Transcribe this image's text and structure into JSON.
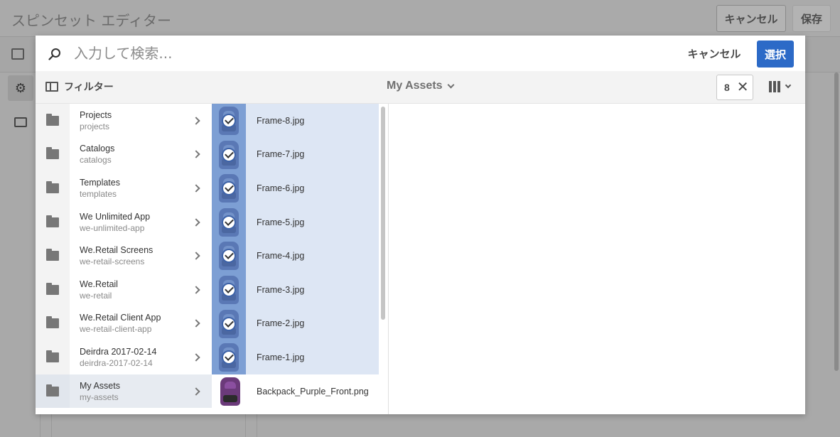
{
  "editor": {
    "title": "スピンセット エディター",
    "cancel_label": "キャンセル",
    "save_label": "保存"
  },
  "picker": {
    "search": {
      "placeholder": "入力して検索...",
      "value": ""
    },
    "cancel_label": "キャンセル",
    "select_label": "選択",
    "filter_label": "フィルター",
    "location_label": "My Assets",
    "selected_count": "8",
    "icons": {
      "search": "search-icon",
      "filter": "filter-panel-icon",
      "chevron": "chevron-down-icon",
      "close": "close-icon",
      "view": "column-view-icon",
      "folder": "folder-icon",
      "check": "checkmark-icon"
    },
    "nav": [
      {
        "title": "Projects",
        "path": "projects",
        "active": false
      },
      {
        "title": "Catalogs",
        "path": "catalogs",
        "active": false
      },
      {
        "title": "Templates",
        "path": "templates",
        "active": false
      },
      {
        "title": "We Unlimited App",
        "path": "we-unlimited-app",
        "active": false
      },
      {
        "title": "We.Retail Screens",
        "path": "we-retail-screens",
        "active": false
      },
      {
        "title": "We.Retail",
        "path": "we-retail",
        "active": false
      },
      {
        "title": "We.Retail Client App",
        "path": "we-retail-client-app",
        "active": false
      },
      {
        "title": "Deirdra 2017-02-14",
        "path": "deirdra-2017-02-14",
        "active": false
      },
      {
        "title": "My Assets",
        "path": "my-assets",
        "active": true
      }
    ],
    "assets": [
      {
        "name": "Frame-8.jpg",
        "selected": true
      },
      {
        "name": "Frame-7.jpg",
        "selected": true
      },
      {
        "name": "Frame-6.jpg",
        "selected": true
      },
      {
        "name": "Frame-5.jpg",
        "selected": true
      },
      {
        "name": "Frame-4.jpg",
        "selected": true
      },
      {
        "name": "Frame-3.jpg",
        "selected": true
      },
      {
        "name": "Frame-2.jpg",
        "selected": true
      },
      {
        "name": "Frame-1.jpg",
        "selected": true
      },
      {
        "name": "Backpack_Purple_Front.png",
        "selected": false
      }
    ],
    "colors": {
      "accent": "#2c6ac7",
      "selected_row": "#dde6f4",
      "selected_thumb": "#7d9fd4",
      "active_nav": "#e7ebf1"
    }
  }
}
